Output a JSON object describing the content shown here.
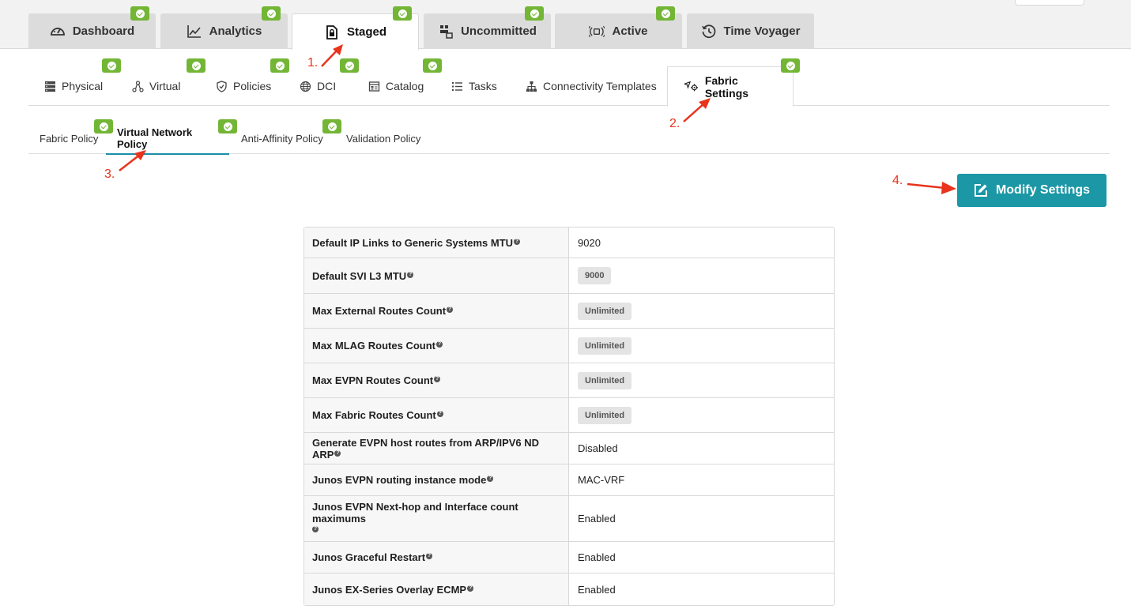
{
  "main_tabs": [
    {
      "label": "Dashboard",
      "icon": "dashboard-gauge-icon"
    },
    {
      "label": "Analytics",
      "icon": "analytics-line-icon"
    },
    {
      "label": "Staged",
      "icon": "staged-lock-icon"
    },
    {
      "label": "Uncommitted",
      "icon": "uncommitted-icon"
    },
    {
      "label": "Active",
      "icon": "active-broadcast-icon"
    },
    {
      "label": "Time Voyager",
      "icon": "history-clock-icon"
    }
  ],
  "sub_tabs": [
    {
      "label": "Physical",
      "icon": "server-stack-icon"
    },
    {
      "label": "Virtual",
      "icon": "network-nodes-icon"
    },
    {
      "label": "Policies",
      "icon": "shield-icon"
    },
    {
      "label": "DCI",
      "icon": "globe-icon"
    },
    {
      "label": "Catalog",
      "icon": "catalog-icon"
    },
    {
      "label": "Tasks",
      "icon": "list-icon"
    },
    {
      "label": "Connectivity Templates",
      "icon": "hierarchy-icon"
    },
    {
      "label": "Fabric Settings",
      "icon": "fabric-settings-icon"
    }
  ],
  "third_tabs": [
    {
      "label": "Fabric Policy"
    },
    {
      "label": "Virtual Network Policy"
    },
    {
      "label": "Anti-Affinity Policy"
    },
    {
      "label": "Validation Policy"
    }
  ],
  "annotations": [
    "1.",
    "2.",
    "3.",
    "4."
  ],
  "modify_button": {
    "label": "Modify Settings",
    "icon": "edit-icon"
  },
  "help_glyph": "?",
  "settings": [
    {
      "key": "Default IP Links to Generic Systems MTU",
      "value": "9020",
      "pill": false
    },
    {
      "key": "Default SVI L3 MTU",
      "value": "9000",
      "pill": true
    },
    {
      "key": "Max External Routes Count",
      "value": "Unlimited",
      "pill": true
    },
    {
      "key": "Max MLAG Routes Count",
      "value": "Unlimited",
      "pill": true
    },
    {
      "key": "Max EVPN Routes Count",
      "value": "Unlimited",
      "pill": true
    },
    {
      "key": "Max Fabric Routes Count",
      "value": "Unlimited",
      "pill": true
    },
    {
      "key": "Generate EVPN host routes from ARP/IPV6 ND ARP",
      "value": "Disabled",
      "pill": false
    },
    {
      "key": "Junos EVPN routing instance mode",
      "value": "MAC-VRF",
      "pill": false
    },
    {
      "key": "Junos EVPN Next-hop and Interface count maximums",
      "value": "Enabled",
      "pill": false
    },
    {
      "key": "Junos Graceful Restart",
      "value": "Enabled",
      "pill": false
    },
    {
      "key": "Junos EX-Series Overlay ECMP",
      "value": "Enabled",
      "pill": false
    }
  ],
  "colors": {
    "accent": "#1b97a6",
    "badge_green": "#73b636",
    "annotation_red": "#e8341c"
  }
}
